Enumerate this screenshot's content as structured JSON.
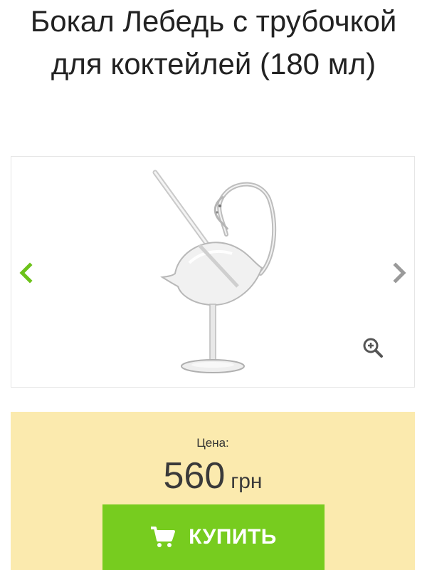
{
  "product": {
    "title": "Бокал Лебедь с трубочкой для коктейлей (180 мл)"
  },
  "gallery": {
    "prev_icon": "chevron-left-icon",
    "next_icon": "chevron-right-icon",
    "zoom_icon": "zoom-in-icon",
    "image": "swan-glass-with-straw"
  },
  "price": {
    "label": "Цена:",
    "value": "560",
    "currency": "грн"
  },
  "buy_button": {
    "label": "КУПИТЬ",
    "icon": "cart-icon"
  },
  "colors": {
    "accent_green": "#77cc1f",
    "price_background": "#fbeaae",
    "arrow_prev": "#6cc21a",
    "arrow_next": "#9a9a9a"
  }
}
